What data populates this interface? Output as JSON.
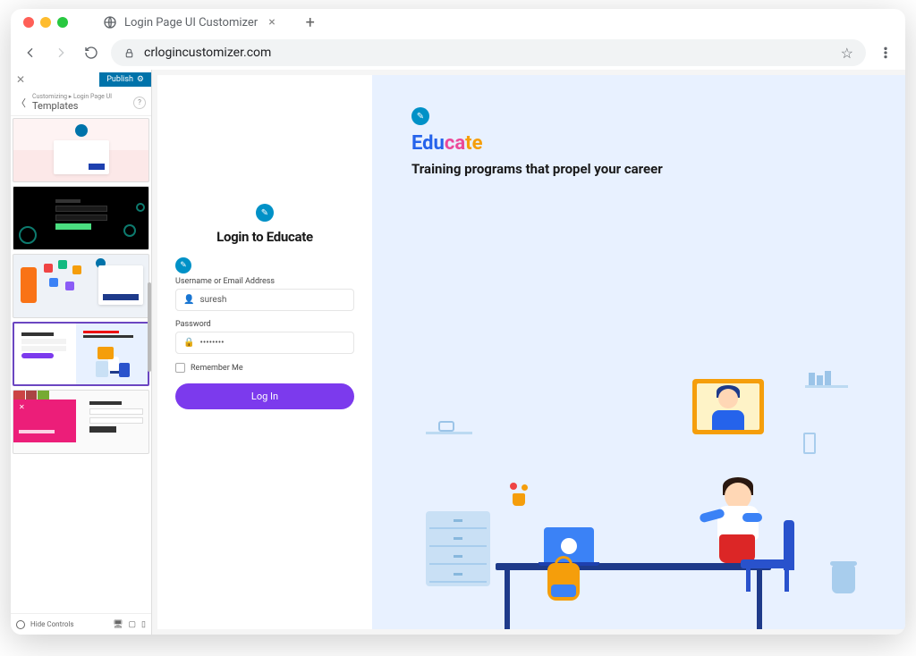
{
  "browser": {
    "tab_title": "Login Page UI Customizer",
    "url": "crlogincustomizer.com"
  },
  "customizer": {
    "publish_label": "Publish",
    "breadcrumb": "Customizing ▸ Login Page UI",
    "section_title": "Templates",
    "hide_controls": "Hide Controls"
  },
  "login": {
    "title": "Login to Educate",
    "username_label": "Username or Email Address",
    "username_value": "suresh",
    "password_label": "Password",
    "password_value": "••••••••",
    "remember_label": "Remember Me",
    "submit_label": "Log In"
  },
  "hero": {
    "title_part1": "Edu",
    "title_part2": "ca",
    "title_part3": "te",
    "subtitle": "Training programs that propel your career"
  }
}
